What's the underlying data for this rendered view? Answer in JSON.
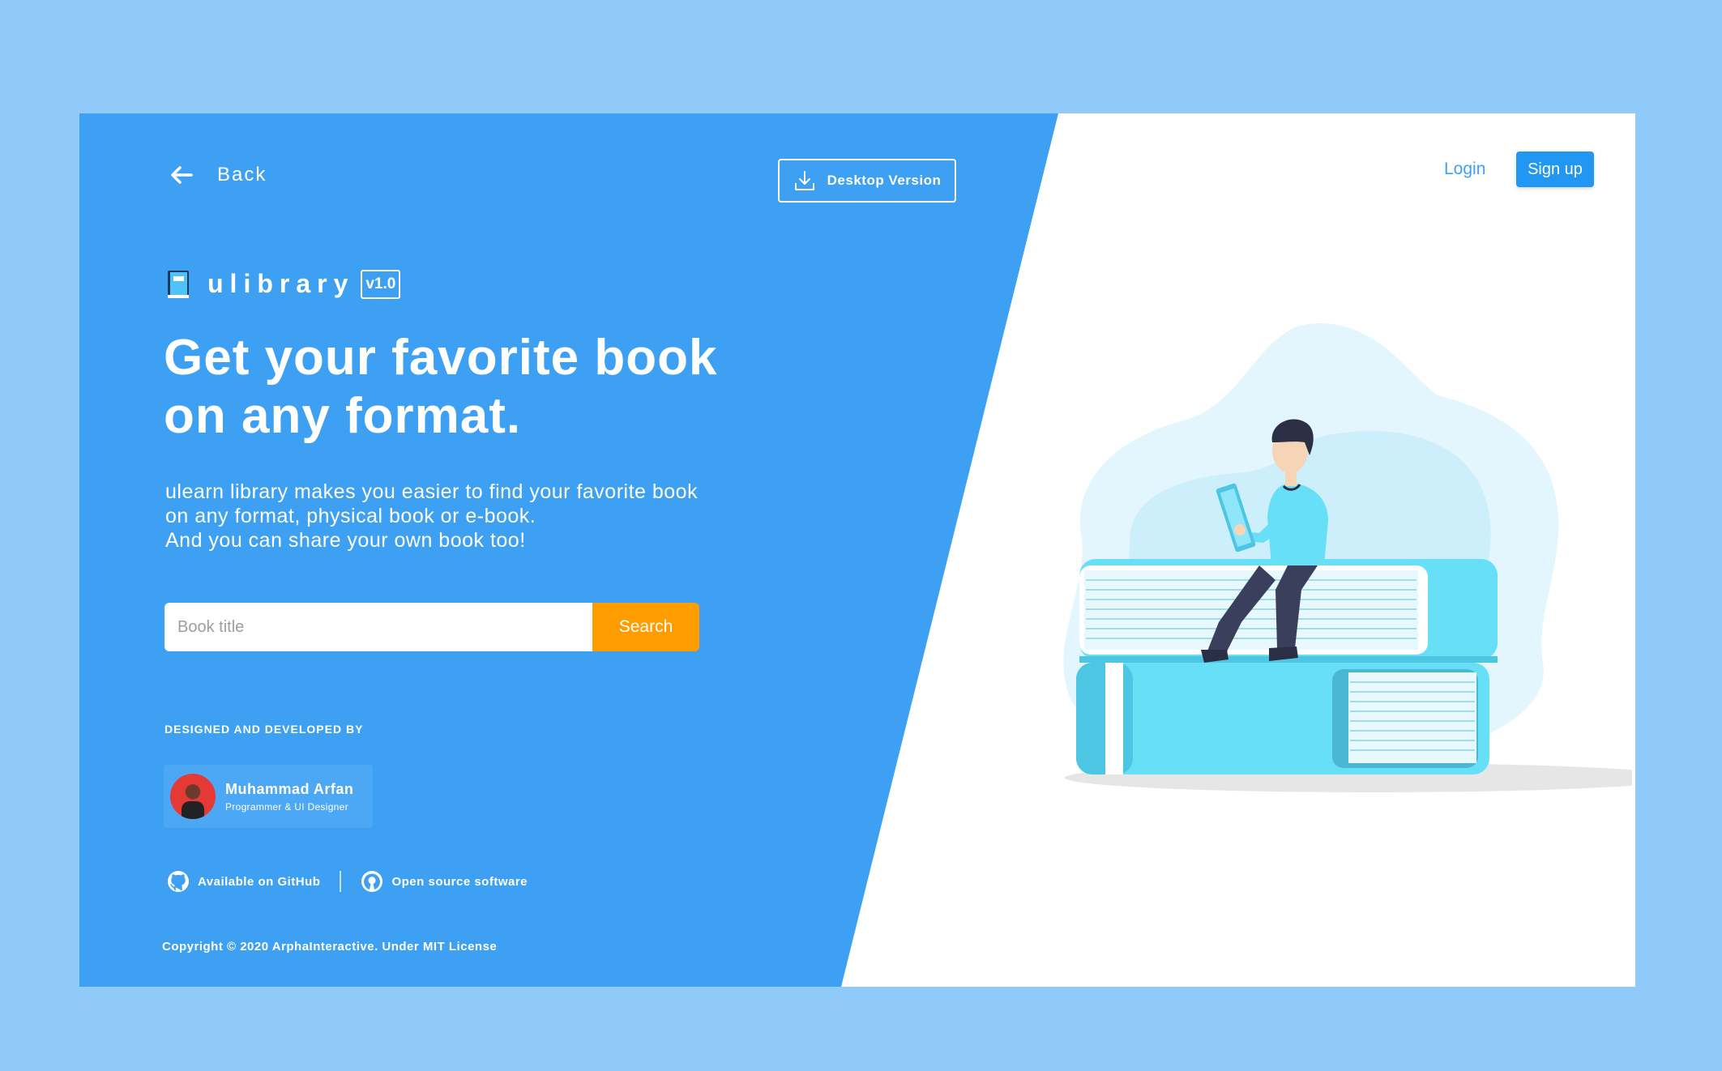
{
  "nav": {
    "back_label": "Back",
    "desktop_label": "Desktop Version",
    "login_label": "Login",
    "signup_label": "Sign up"
  },
  "brand": {
    "name": "ulibrary",
    "version": "v1.0"
  },
  "hero": {
    "headline_line1": "Get your favorite book",
    "headline_line2": "on any format.",
    "desc_line1": "ulearn library makes you easier to find your favorite book",
    "desc_line2": "on any format, physical book or e-book.",
    "desc_line3": "And you can share your own book too!"
  },
  "search": {
    "placeholder": "Book title",
    "value": "",
    "button_label": "Search"
  },
  "credits": {
    "heading": "DESIGNED AND DEVELOPED BY",
    "author_name": "Muhammad Arfan",
    "author_role": "Programmer  & UI Designer"
  },
  "links": {
    "github_label": "Available on GitHub",
    "opensource_label": "Open source software"
  },
  "footer": {
    "copyright": "Copyright © 2020 ArphaInteractive. Under MIT License"
  },
  "icons": [
    "arrow-left-icon",
    "download-icon",
    "book-logo-icon",
    "github-icon",
    "open-source-icon"
  ],
  "colors": {
    "background": "#90caf9",
    "panel": "#3da0f3",
    "accent": "#ff9c00",
    "primary": "#2196f3"
  }
}
